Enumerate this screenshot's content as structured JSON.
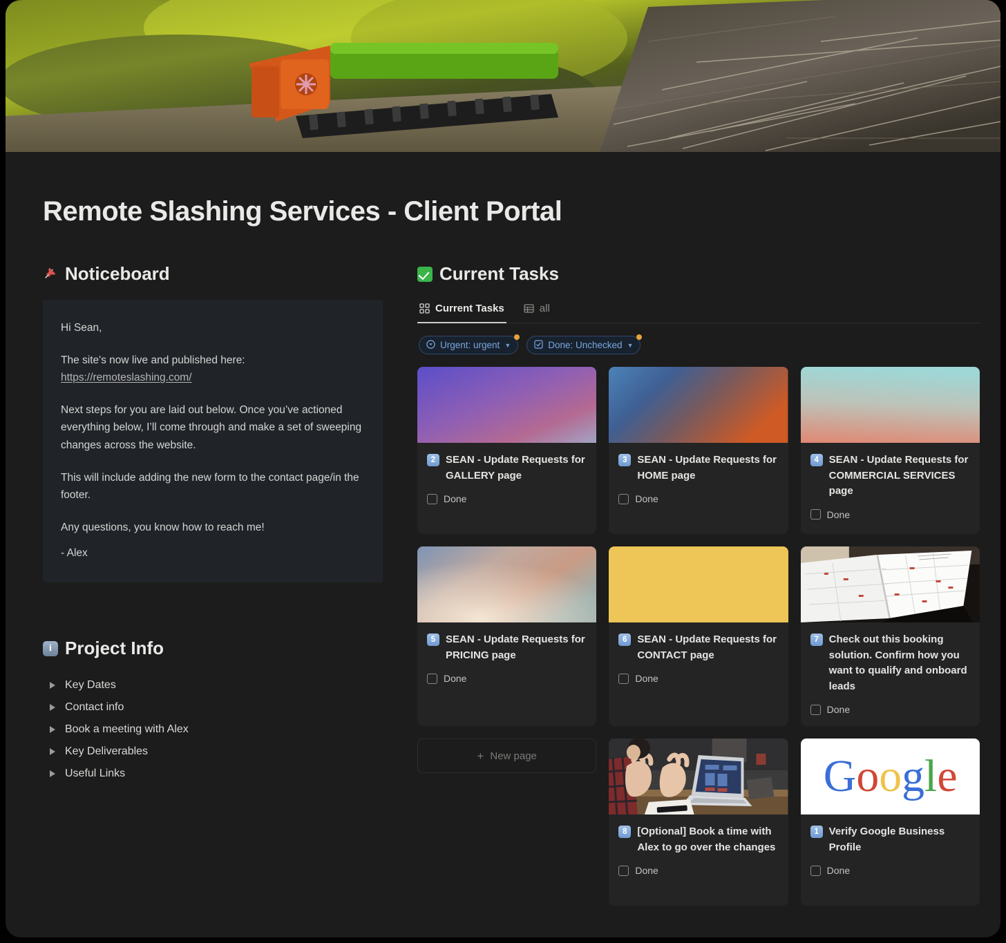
{
  "page": {
    "title": "Remote Slashing Services - Client Portal",
    "banner_alt": "forestry mulcher machine clearing brush"
  },
  "noticeboard": {
    "emoji": "pushpin",
    "heading": "Noticeboard",
    "greeting": "Hi Sean,",
    "live_line": "The site's now live and published here:",
    "link_text": "https://remoteslashing.com/",
    "paragraph_next_steps": "Next steps for you are laid out below. Once you’ve actioned everything below, I’ll come through and make a set of sweeping changes across the website.",
    "paragraph_form": "This will include adding the new form to the contact page/in the footer.",
    "paragraph_questions": "Any questions, you know how to reach me!",
    "signature": "- Alex"
  },
  "project_info": {
    "emoji": "information",
    "heading": "Project Info",
    "items": [
      {
        "label": "Key Dates"
      },
      {
        "label": "Contact info"
      },
      {
        "label": "Book a meeting with Alex"
      },
      {
        "label": "Key Deliverables"
      },
      {
        "label": "Useful Links"
      }
    ]
  },
  "tasks": {
    "emoji": "check-mark-button",
    "heading": "Current Tasks",
    "tabs": [
      {
        "label": "Current Tasks",
        "icon": "gallery-view-icon",
        "active": true
      },
      {
        "label": "all",
        "icon": "table-view-icon",
        "active": false
      }
    ],
    "filters": [
      {
        "label": "Urgent: urgent",
        "icon": "select-property-icon",
        "has_dot": true
      },
      {
        "label": "Done: Unchecked",
        "icon": "checkbox-property-icon",
        "has_dot": true
      }
    ],
    "done_label": "Done",
    "new_page_label": "New page",
    "cards": [
      {
        "number": "2",
        "title": "SEAN - Update Requests for GALLERY page",
        "done": false,
        "cover": "gradient-purple-pink"
      },
      {
        "number": "3",
        "title": "SEAN - Update Requests for HOME page",
        "done": false,
        "cover": "gradient-blue-orange"
      },
      {
        "number": "4",
        "title": "SEAN - Update Requests for COMMERCIAL SERVICES page",
        "done": false,
        "cover": "gradient-teal-salmon"
      },
      {
        "number": "5",
        "title": "SEAN - Update Requests for PRICING page",
        "done": false,
        "cover": "gradient-blue-peach"
      },
      {
        "number": "6",
        "title": "SEAN - Update Requests for CONTACT page",
        "done": false,
        "cover": "solid-yellow"
      },
      {
        "number": "7",
        "title": "Check out this booking solution. Confirm how you want to qualify and onboard leads",
        "done": false,
        "cover": "photo-open-planner"
      },
      {
        "number": "8",
        "title": "[Optional] Book a time with Alex to go over the changes",
        "done": false,
        "cover": "photo-meeting-laptop"
      },
      {
        "number": "1",
        "title": "Verify Google Business Profile",
        "done": false,
        "cover": "logo-google"
      }
    ]
  },
  "colors": {
    "page_bg": "#1c1c1c",
    "callout_bg": "#202429",
    "card_bg": "#242424",
    "text": "#e9e9e7",
    "chip_blue": "#7aa7e0",
    "chip_dot_orange": "#e8a33d",
    "number_badge_blue": "#7da3d4",
    "yellow_cover": "#eec557"
  }
}
